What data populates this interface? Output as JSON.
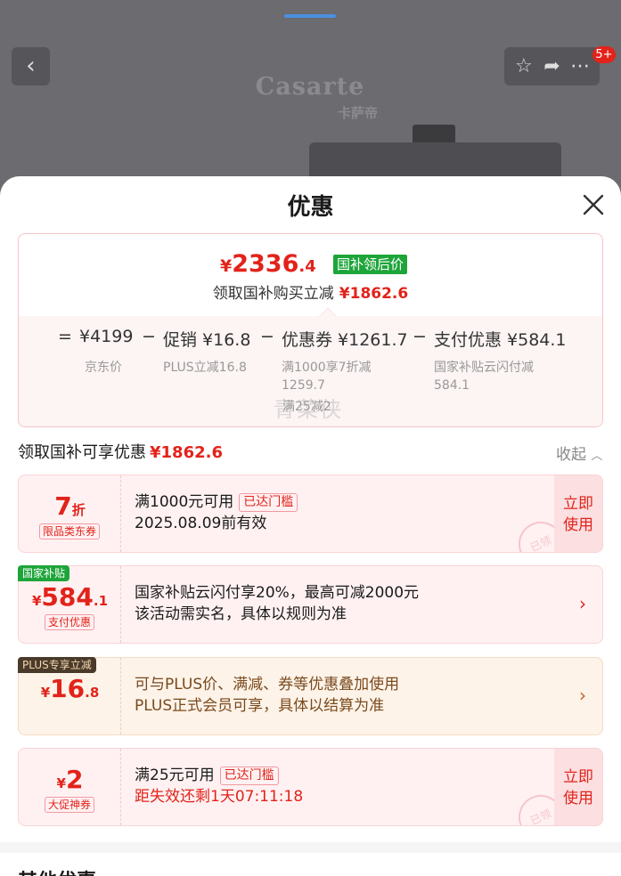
{
  "background": {
    "back_icon": "chevron-left-icon",
    "logo": "Casarte",
    "logo_sub": "卡萨帝",
    "toolbar_icons": [
      "star-icon",
      "share-icon",
      "more-icon"
    ],
    "badge_count": "5+"
  },
  "sheet": {
    "title": "优惠",
    "close_icon": "close-icon"
  },
  "price": {
    "currency": "¥",
    "final_int": "2336",
    "final_dec": ".4",
    "tag": "国补领后价",
    "subline_label": "领取国补购买立减",
    "subline_value": "¥1862.6"
  },
  "formula": {
    "eq": "=",
    "base_price": "¥4199",
    "base_label": "京东价",
    "minus1": "−",
    "promo": "促销 ¥16.8",
    "promo_note": "PLUS立减16.8",
    "minus2": "−",
    "coupon": "优惠券 ¥1261.7",
    "coupon_note_1": "满1000享7折减",
    "coupon_note_2": "1259.7",
    "coupon_note_3": "满25减2",
    "minus3": "−",
    "pay": "支付优惠 ¥584.1",
    "pay_note_1": "国家补贴云闪付减",
    "pay_note_2": "584.1",
    "watermark": "青菜侠"
  },
  "section": {
    "title": "领取国补可享优惠",
    "value": "¥1862.6",
    "collapse": "收起",
    "collapse_icon": "chevron-up-icon"
  },
  "coupons": [
    {
      "amount": "7",
      "amount_suffix": "折",
      "label": "限品类东券",
      "line1": "满1000元可用",
      "threshold": "已达门槛",
      "line2": "2025.08.09前有效",
      "action_1": "立即",
      "action_2": "使用",
      "stamp": "已领"
    },
    {
      "corner": "国家补贴",
      "currency": "¥",
      "amount": "584",
      "amount_suffix": ".1",
      "label": "支付优惠",
      "line1": "国家补贴云闪付享20%，最高可减2000元",
      "line2": "该活动需实名，具体以规则为准",
      "arrow_icon": "chevron-right-icon"
    },
    {
      "corner": "PLUS专享立减",
      "currency": "¥",
      "amount": "16",
      "amount_suffix": ".8",
      "line1": "可与PLUS价、满减、券等优惠叠加使用",
      "line2": "PLUS正式会员可享，具体以结算为准",
      "arrow_icon": "chevron-right-icon"
    },
    {
      "currency": "¥",
      "amount": "2",
      "label": "大促神券",
      "line1": "满25元可用",
      "threshold": "已达门槛",
      "line2": "距失效还剩1天07:11:18",
      "action_1": "立即",
      "action_2": "使用",
      "stamp": "已领"
    }
  ],
  "other": {
    "title": "其他优惠"
  },
  "colors": {
    "accent_red": "#e2231a",
    "tag_green": "#1ea53a",
    "plus_brown": "#7a4a1c"
  }
}
